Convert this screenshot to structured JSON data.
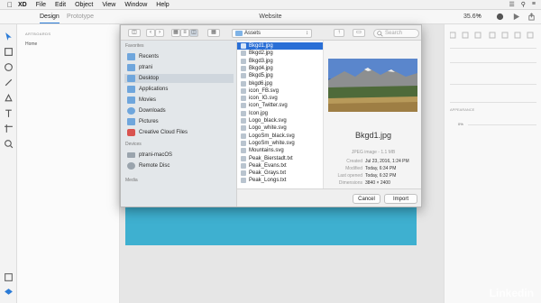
{
  "menubar": {
    "app_name": "XD",
    "items": [
      "File",
      "Edit",
      "Object",
      "View",
      "Window",
      "Help"
    ]
  },
  "titlebar": {
    "tabs": [
      "Design",
      "Prototype"
    ],
    "document_title": "Website",
    "zoom": "35.6%"
  },
  "artboards_panel": {
    "heading": "ARTBOARDS",
    "items": [
      "Home"
    ]
  },
  "right_panel": {
    "appearance_heading": "APPEARANCE",
    "opacity_value": "0%"
  },
  "dialog": {
    "current_folder": "Assets",
    "search_placeholder": "Search",
    "sidebar": {
      "favorites_heading": "Favorites",
      "favorites": [
        "Recents",
        "ptrani",
        "Desktop",
        "Applications",
        "Movies",
        "Downloads",
        "Pictures",
        "Creative Cloud Files"
      ],
      "devices_heading": "Devices",
      "devices": [
        "ptrani-macOS",
        "Remote Disc"
      ],
      "media_heading": "Media"
    },
    "files": [
      "Bkgd1.jpg",
      "Bkgd2.jpg",
      "Bkgd3.jpg",
      "Bkgd4.jpg",
      "Bkgd5.jpg",
      "bkgd6.jpg",
      "icon_FB.svg",
      "icon_IG.svg",
      "icon_Twitter.svg",
      "Icon.jpg",
      "Logo_black.svg",
      "Logo_white.svg",
      "LogoSm_black.svg",
      "LogoSm_white.svg",
      "Mountains.svg",
      "Peak_Bierstadt.txt",
      "Peak_Evans.txt",
      "Peak_Grays.txt",
      "Peak_Longs.txt"
    ],
    "selected_index": 0,
    "preview": {
      "name": "Bkgd1.jpg",
      "kind": "JPEG image - 1.1 MB",
      "meta": [
        {
          "key": "Created",
          "value": "Jul 23, 2016, 1:24 PM"
        },
        {
          "key": "Modified",
          "value": "Today, 6:34 PM"
        },
        {
          "key": "Last opened",
          "value": "Today, 6:32 PM"
        },
        {
          "key": "Dimensions",
          "value": "3840 × 2400"
        }
      ]
    },
    "cancel_label": "Cancel",
    "import_label": "Import"
  },
  "watermark": "Linkedin",
  "colors": {
    "accent_blue": "#2a6fd6",
    "artboard_band": "#3eb0d0",
    "sidebar_bg": "#e3e7ea"
  }
}
